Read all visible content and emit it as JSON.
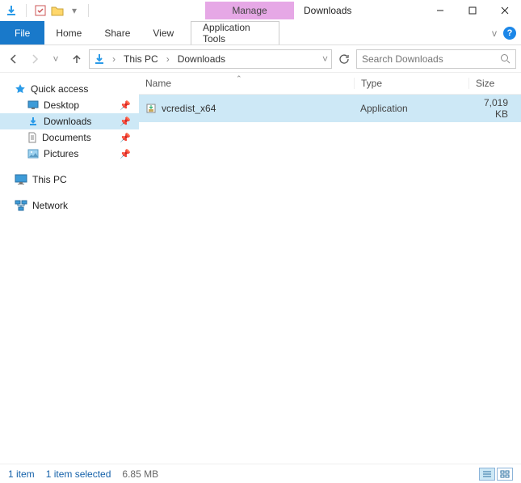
{
  "title_bar": {
    "contextual_tab": "Manage",
    "window_title": "Downloads"
  },
  "ribbon": {
    "file": "File",
    "home": "Home",
    "share": "Share",
    "view": "View",
    "tools": "Application Tools",
    "minimize_ribbon_glyph": "v",
    "help_glyph": "?"
  },
  "nav": {
    "breadcrumb": [
      "This PC",
      "Downloads"
    ],
    "search_placeholder": "Search Downloads"
  },
  "sidebar": {
    "quick_access": "Quick access",
    "items": [
      {
        "label": "Desktop",
        "icon": "desktop"
      },
      {
        "label": "Downloads",
        "icon": "downloads",
        "selected": true
      },
      {
        "label": "Documents",
        "icon": "documents"
      },
      {
        "label": "Pictures",
        "icon": "pictures"
      }
    ],
    "this_pc": "This PC",
    "network": "Network"
  },
  "columns": {
    "name": "Name",
    "type": "Type",
    "size": "Size"
  },
  "files": [
    {
      "name": "vcredist_x64",
      "type": "Application",
      "size": "7,019 KB",
      "selected": true
    }
  ],
  "status": {
    "count": "1 item",
    "selected": "1 item selected",
    "sel_size": "6.85 MB"
  }
}
